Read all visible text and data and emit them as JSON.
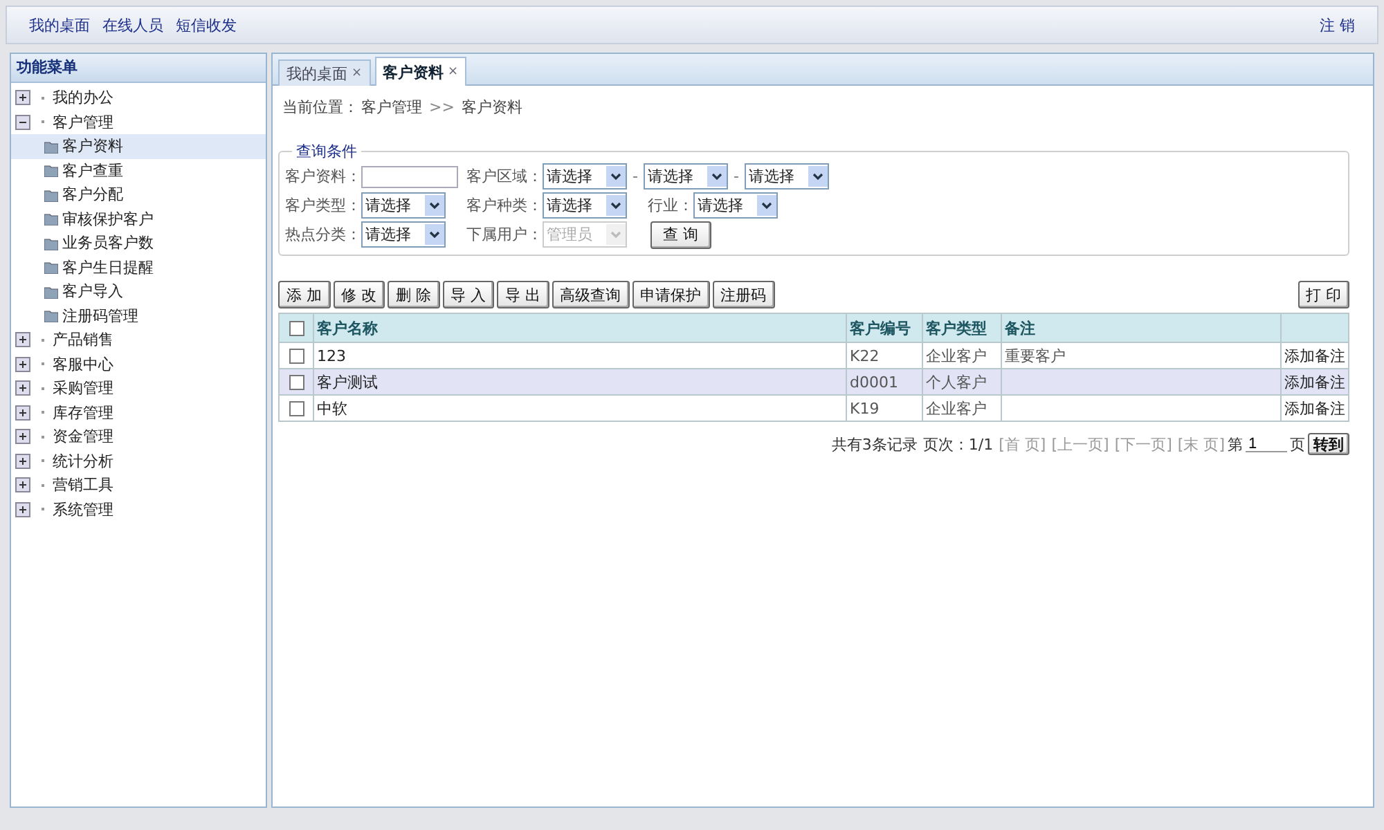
{
  "top_links": [
    "我的桌面",
    "在线人员",
    "短信收发"
  ],
  "logout": "注 销",
  "sidebar": {
    "title": "功能菜单",
    "items": [
      {
        "label": "我的办公",
        "expanded": false
      },
      {
        "label": "客户管理",
        "expanded": true,
        "children": [
          {
            "label": "客户资料",
            "selected": true
          },
          {
            "label": "客户查重",
            "selected": false
          },
          {
            "label": "客户分配",
            "selected": false
          },
          {
            "label": "审核保护客户",
            "selected": false
          },
          {
            "label": "业务员客户数",
            "selected": false
          },
          {
            "label": "客户生日提醒",
            "selected": false
          },
          {
            "label": "客户导入",
            "selected": false
          },
          {
            "label": "注册码管理",
            "selected": false
          }
        ]
      },
      {
        "label": "产品销售",
        "expanded": false
      },
      {
        "label": "客服中心",
        "expanded": false
      },
      {
        "label": "采购管理",
        "expanded": false
      },
      {
        "label": "库存管理",
        "expanded": false
      },
      {
        "label": "资金管理",
        "expanded": false
      },
      {
        "label": "统计分析",
        "expanded": false
      },
      {
        "label": "营销工具",
        "expanded": false
      },
      {
        "label": "系统管理",
        "expanded": false
      }
    ]
  },
  "tabs": [
    {
      "label": "我的桌面",
      "close": "×",
      "selected": false
    },
    {
      "label": "客户资料",
      "close": "×",
      "selected": true
    }
  ],
  "breadcrumb": {
    "prefix": "当前位置：",
    "path": "客户管理",
    "separator": ">>",
    "current": "客户资料"
  },
  "query": {
    "legend": "查询条件",
    "rows": [
      [
        {
          "label": "客户资料：",
          "controls": [
            {
              "kind": "text"
            }
          ]
        },
        {
          "label": "客户区域：",
          "separator": "-",
          "controls": [
            {
              "kind": "select",
              "value": "请选择",
              "disabled": false
            },
            {
              "kind": "select",
              "value": "请选择",
              "disabled": false
            },
            {
              "kind": "select",
              "value": "请选择",
              "disabled": false
            }
          ]
        }
      ],
      [
        {
          "label": "客户类型：",
          "controls": [
            {
              "kind": "select",
              "value": "请选择",
              "disabled": false
            }
          ]
        },
        {
          "label": "客户种类：",
          "controls": [
            {
              "kind": "select",
              "value": "请选择",
              "disabled": false
            }
          ]
        },
        {
          "label": "行业：",
          "controls": [
            {
              "kind": "select",
              "value": "请选择",
              "disabled": false
            }
          ]
        }
      ],
      [
        {
          "label": "热点分类：",
          "controls": [
            {
              "kind": "select",
              "value": "请选择",
              "disabled": false
            }
          ]
        },
        {
          "label": "下属用户：",
          "controls": [
            {
              "kind": "select",
              "value": "管理员",
              "disabled": true
            }
          ]
        },
        {
          "controls": [
            {
              "kind": "button",
              "value": "查 询"
            }
          ]
        }
      ]
    ]
  },
  "toolbar": [
    "添 加",
    "修 改",
    "删 除",
    "导 入",
    "导 出",
    "高级查询",
    "申请保护",
    "注册码"
  ],
  "print_button": "打 印",
  "table": {
    "all_checked": false,
    "columns": [
      "客户名称",
      "客户编号",
      "客户类型",
      "备注"
    ],
    "rows": [
      {
        "checked": false,
        "selected": false,
        "cells": [
          "123",
          "K22",
          "企业客户",
          "重要客户"
        ],
        "action": "添加备注"
      },
      {
        "checked": false,
        "selected": true,
        "cells": [
          "客户测试",
          "d0001",
          "个人客户",
          ""
        ],
        "action": "添加备注"
      },
      {
        "checked": false,
        "selected": false,
        "cells": [
          "中软",
          "K19",
          "企业客户",
          ""
        ],
        "action": "添加备注"
      }
    ]
  },
  "pager": {
    "summary": "共有3条记录",
    "pages": "页次：1/1",
    "links": [
      {
        "label": "[首 页]",
        "disabled": true
      },
      {
        "label": "[上一页]",
        "disabled": true
      },
      {
        "label": "[下一页]",
        "disabled": true
      },
      {
        "label": "[末 页]",
        "disabled": true
      }
    ],
    "page_prefix": "第",
    "page_value": "1",
    "page_suffix": "页",
    "go": "转到"
  }
}
